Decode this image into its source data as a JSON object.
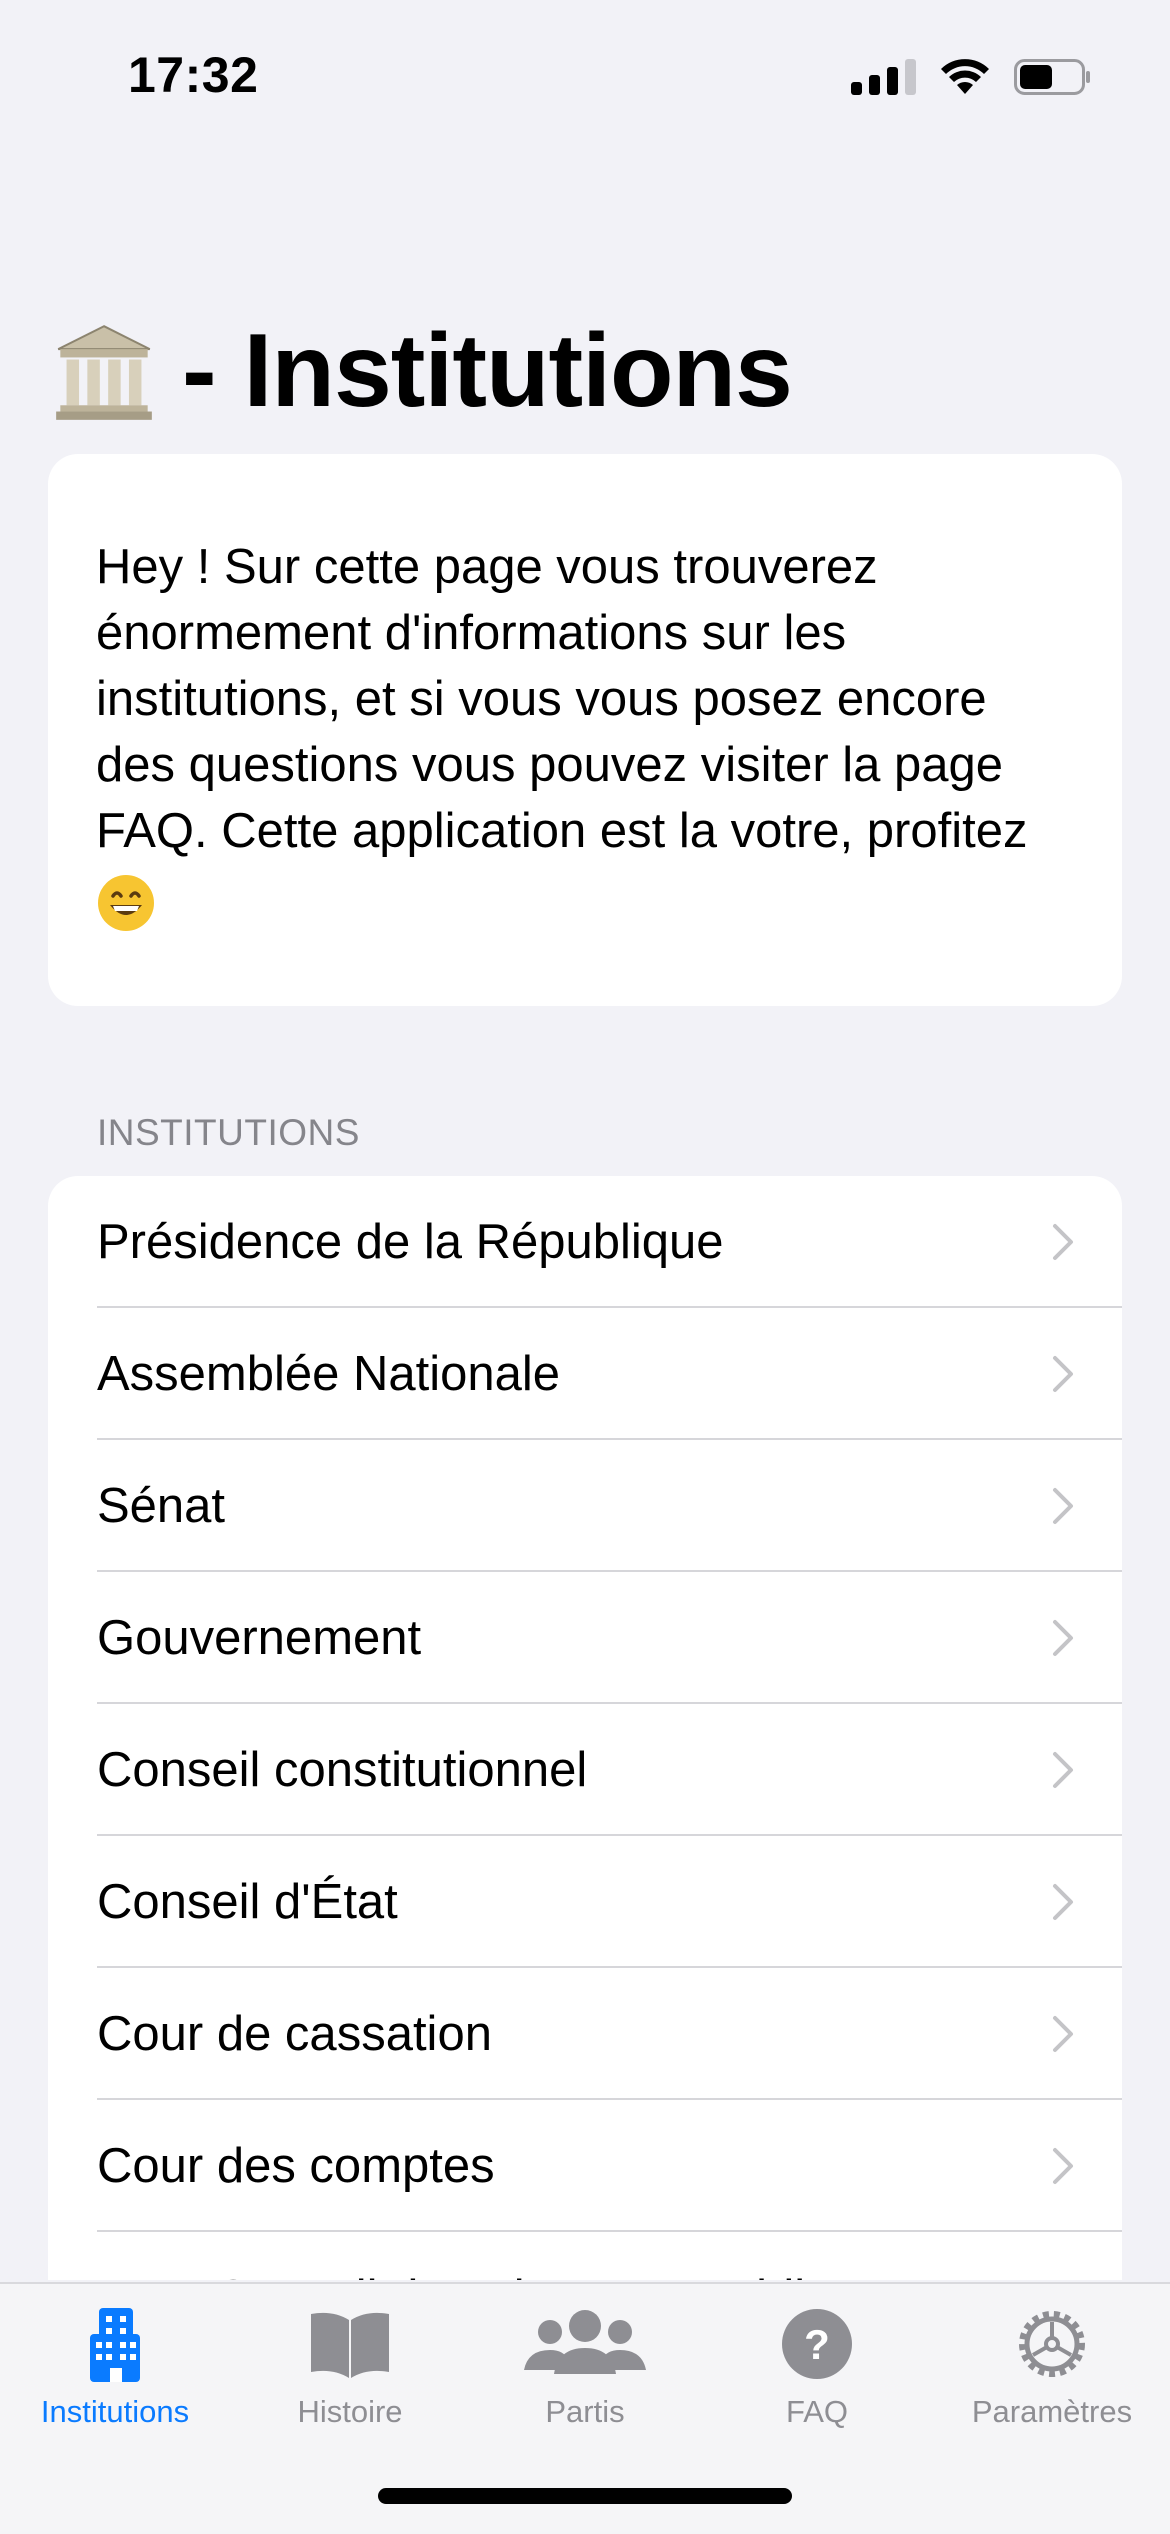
{
  "status": {
    "time": "17:32",
    "battery_level": 0.55
  },
  "header": {
    "title": "- Institutions",
    "icon": "classical-building-icon"
  },
  "intro": {
    "text": "Hey  ! Sur cette page vous trouverez énormement d'informations sur les institutions, et si vous vous posez encore des questions vous pouvez visiter la page FAQ. Cette application est la votre, profitez",
    "emoji": "grinning-face-icon"
  },
  "section": {
    "header": "INSTITUTIONS"
  },
  "list": {
    "items": [
      {
        "label": "Présidence de la République"
      },
      {
        "label": "Assemblée Nationale"
      },
      {
        "label": "Sénat"
      },
      {
        "label": "Gouvernement"
      },
      {
        "label": "Conseil constitutionnel"
      },
      {
        "label": "Conseil d'État"
      },
      {
        "label": "Cour de cassation"
      },
      {
        "label": "Cour des comptes"
      },
      {
        "label": "Haut Conseil des Finances Publiques"
      }
    ]
  },
  "tabs": [
    {
      "label": "Institutions",
      "icon": "building-icon",
      "active": true
    },
    {
      "label": "Histoire",
      "icon": "book-icon",
      "active": false
    },
    {
      "label": "Partis",
      "icon": "people-icon",
      "active": false
    },
    {
      "label": "FAQ",
      "icon": "question-icon",
      "active": false
    },
    {
      "label": "Paramètres",
      "icon": "gear-icon",
      "active": false
    }
  ],
  "colors": {
    "accent": "#0a7bff",
    "inactive": "#8e8e93",
    "background": "#f2f2f7"
  }
}
